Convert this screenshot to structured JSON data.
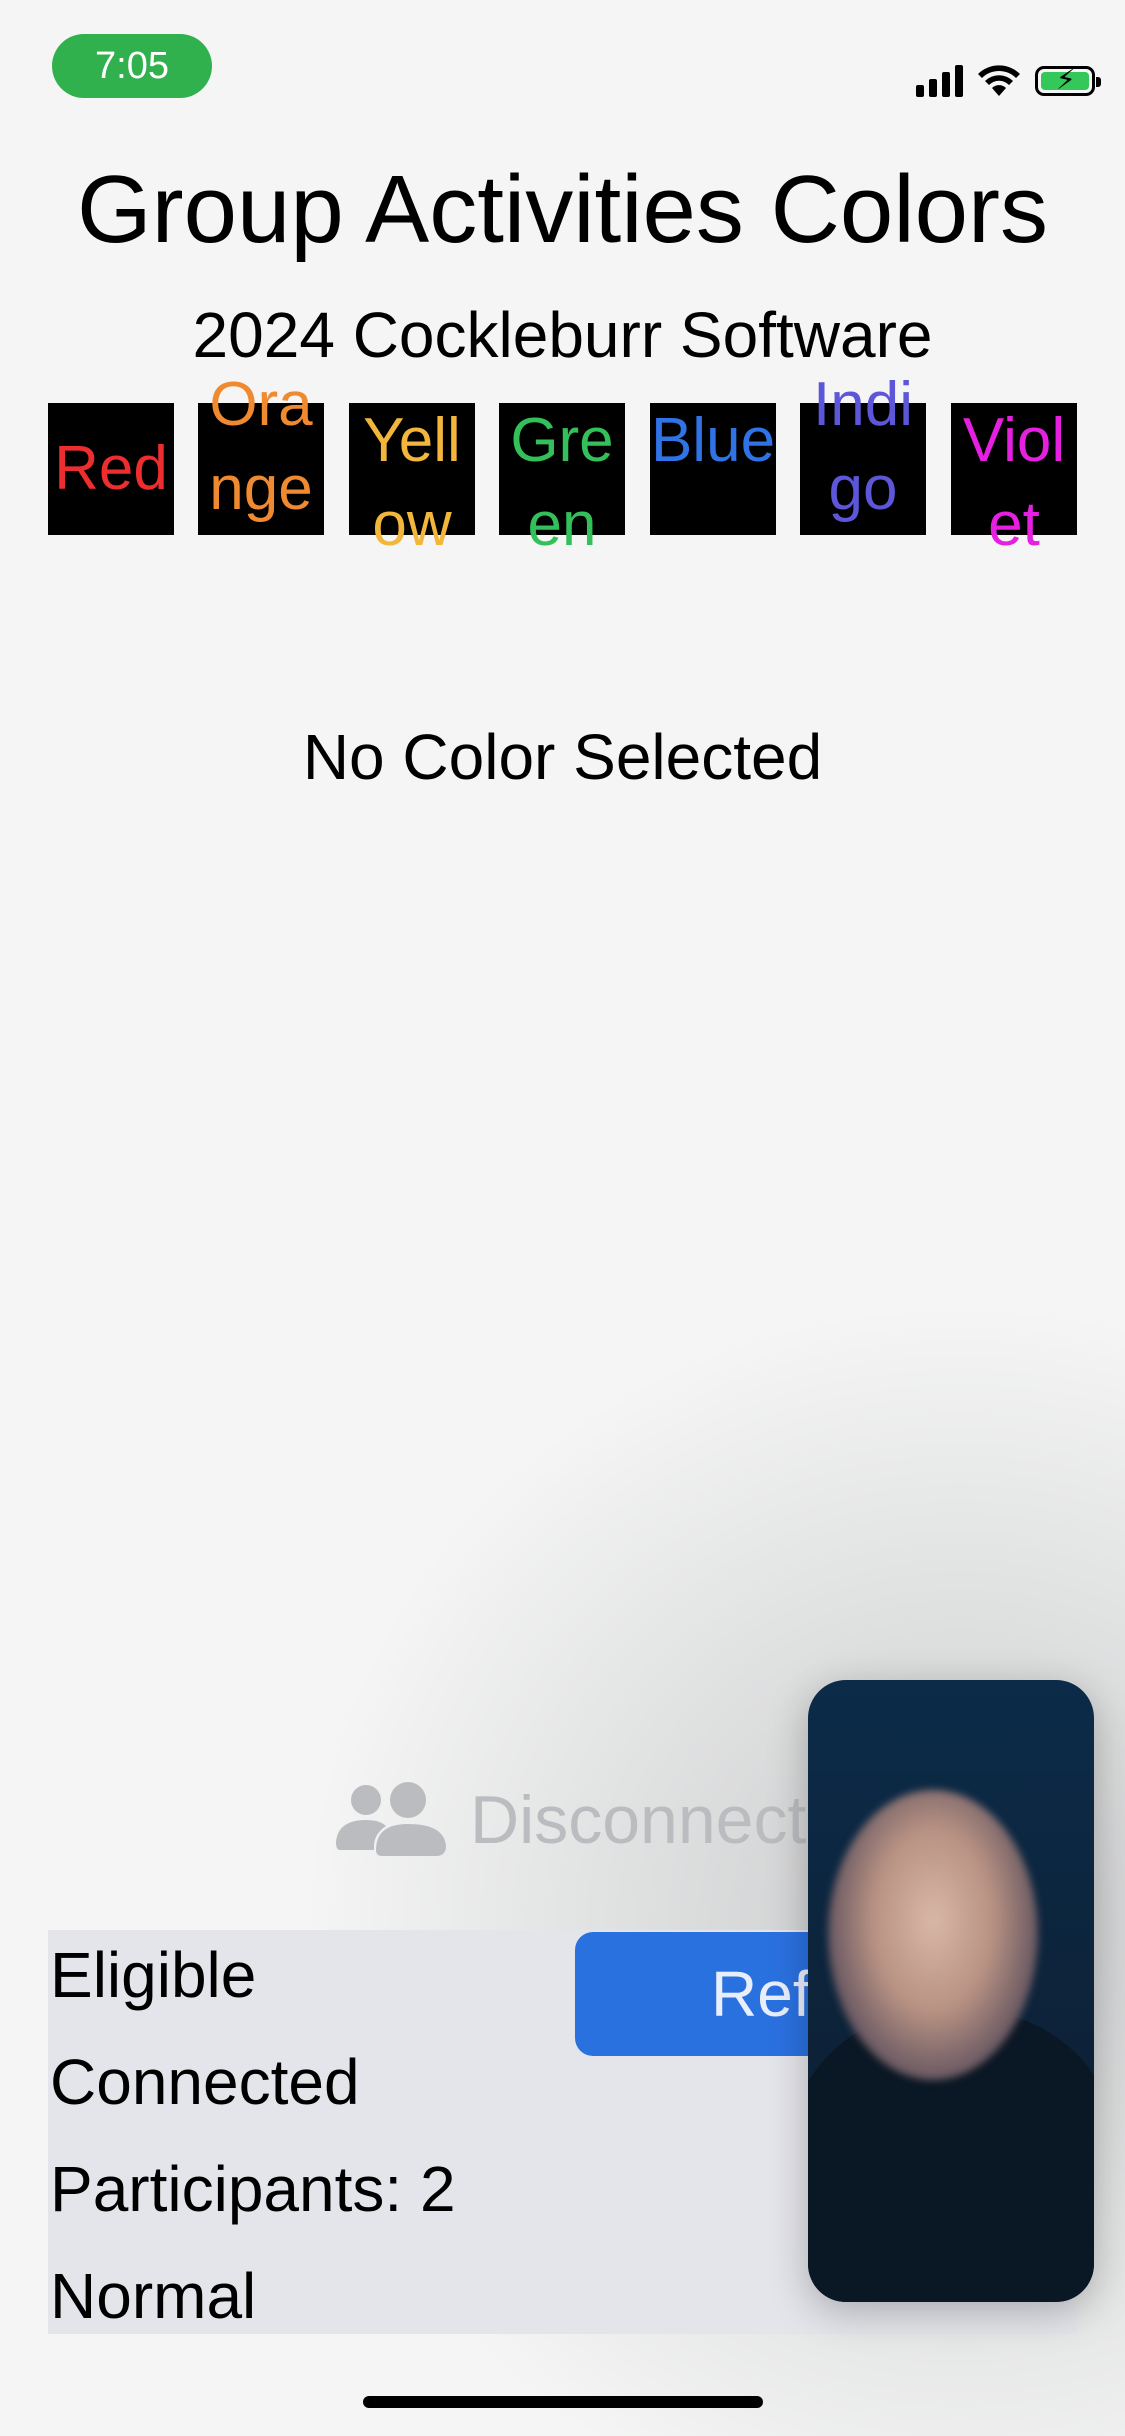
{
  "status_bar": {
    "time": "7:05"
  },
  "header": {
    "title": "Group Activities Colors",
    "subtitle": "2024 Cockleburr Software"
  },
  "colors": [
    {
      "label": "Red",
      "color": "#ee2e2e"
    },
    {
      "label": "Orange",
      "color": "#f08a30"
    },
    {
      "label": "Yellow",
      "color": "#f3b63c"
    },
    {
      "label": "Green",
      "color": "#33c05a"
    },
    {
      "label": "Blue",
      "color": "#2f73e6"
    },
    {
      "label": "Indigo",
      "color": "#5d56d8"
    },
    {
      "label": "Violet",
      "color": "#e520e0"
    }
  ],
  "selection": {
    "text": "No Color Selected"
  },
  "session": {
    "disconnect_label": "Disconnect",
    "refresh_label": "Refresh",
    "eligibility": "Eligible",
    "state": "Connected",
    "participants": "Participants: 2",
    "mode": "Normal"
  },
  "icons": {
    "cellular": "cellular-signal-icon",
    "wifi": "wifi-icon",
    "battery": "battery-charging-icon",
    "people": "people-icon"
  }
}
